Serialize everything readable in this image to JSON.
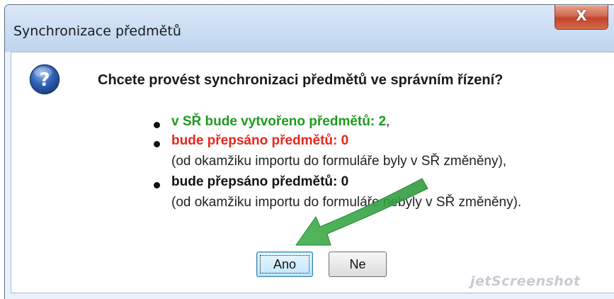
{
  "window": {
    "title": "Synchronizace předmětů",
    "close_label": "X"
  },
  "dialog": {
    "icon": "question-icon",
    "question": "Chcete provést synchronizaci předmětů ve správním řízení?",
    "items": [
      {
        "text": "v SŘ bude vytvořeno předmětů: 2",
        "suffix": ",",
        "color": "#1e9a1e"
      },
      {
        "text": "bude přepsáno předmětů: 0",
        "note": "(od okamžiku importu do formuláře byly v SŘ změněny),",
        "color": "#e8261b"
      },
      {
        "text": "bude přepsáno předmětů: 0",
        "note": "(od okamžiku importu do formuláře nebyly v SŘ změněny).",
        "color": "#111111"
      }
    ],
    "buttons": {
      "yes": "Ano",
      "no": "Ne"
    }
  },
  "watermark": "jetScreenshot"
}
